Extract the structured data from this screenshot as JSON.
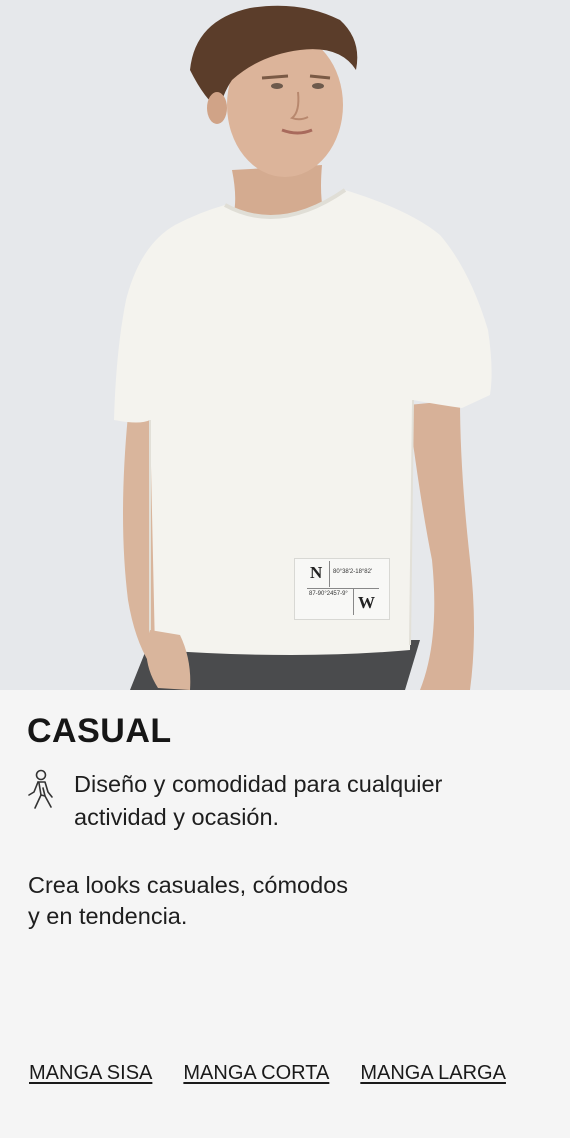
{
  "hero": {
    "image": "model-white-tshirt-photo",
    "label": {
      "top_letter": "N",
      "bottom_letter": "W",
      "top_code": "80°38'2-18°82'",
      "bottom_code": "87-90°2457-9°"
    }
  },
  "category": {
    "title": "CASUAL",
    "feature_icon": "walking-person-icon",
    "feature_text": "Diseño y comodidad para cualquier actividad y ocasión.",
    "tagline_line1": "Crea looks casuales, cómodos",
    "tagline_line2": "y en tendencia."
  },
  "links": [
    {
      "label": "MANGA SISA"
    },
    {
      "label": "MANGA CORTA"
    },
    {
      "label": "MANGA LARGA"
    }
  ],
  "colors": {
    "hero_background": "#e6e8eb",
    "panel_background": "#f5f5f5",
    "text": "#1a1a1a"
  }
}
